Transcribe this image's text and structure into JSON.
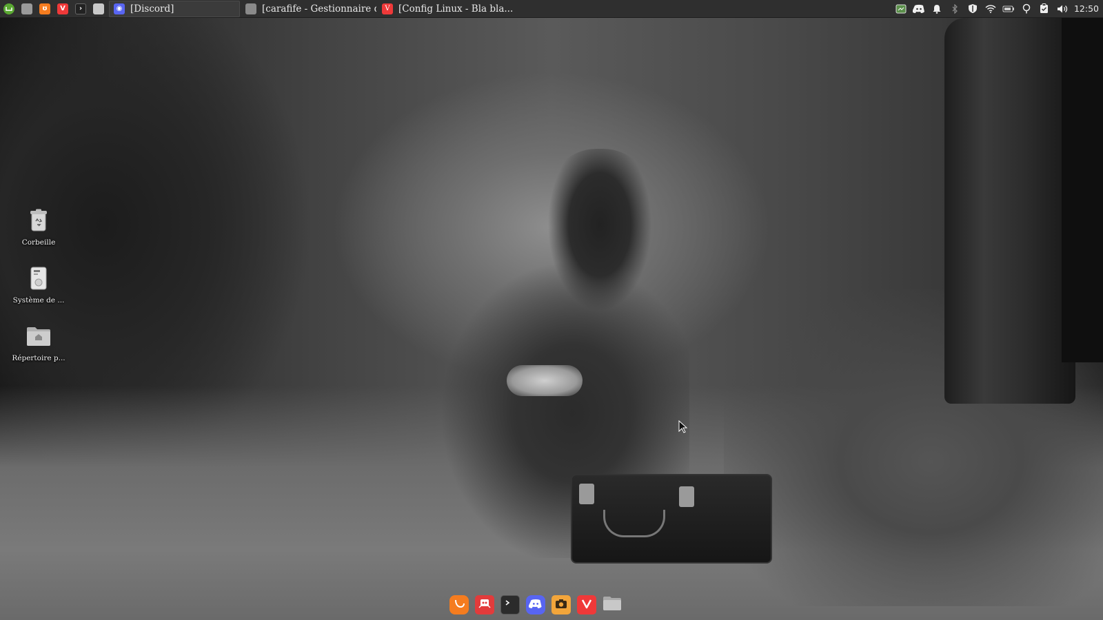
{
  "panel": {
    "launchers": [
      {
        "icon": "mint-menu-icon",
        "color": "#5aa832"
      },
      {
        "icon": "show-desktop-icon",
        "color": "#9a9a9a"
      },
      {
        "icon": "firefox-icon",
        "color": "#f57c1f"
      },
      {
        "icon": "vivaldi-icon",
        "color": "#ef3939"
      },
      {
        "icon": "terminal-icon",
        "color": "#222222"
      },
      {
        "icon": "file-manager-icon",
        "color": "#c9c9c9"
      }
    ],
    "tasks": [
      {
        "label": "[Discord]",
        "icon": "discord-icon",
        "color": "#5865f2",
        "active": true
      },
      {
        "label": "[carafife - Gestionnaire de ...",
        "icon": "folder-icon",
        "color": "#8a8a8a",
        "active": false
      },
      {
        "label": "[Config Linux - Bla bla... - ...",
        "icon": "vivaldi-icon",
        "color": "#ef3939",
        "active": false
      }
    ],
    "tray": [
      "screenshot-app-icon",
      "discord-tray-icon",
      "notifications-icon",
      "bluetooth-icon",
      "shield-icon",
      "wifi-icon",
      "battery-icon",
      "location-icon",
      "clipboard-icon",
      "volume-icon"
    ],
    "clock": "12:50"
  },
  "desktop_icons": [
    {
      "label": "Corbeille",
      "icon": "trash-icon"
    },
    {
      "label": "Système de ...",
      "icon": "drive-icon"
    },
    {
      "label": "Répertoire p...",
      "icon": "home-folder-icon"
    }
  ],
  "dock": [
    {
      "icon": "firefox-icon",
      "color": "#f57c1f"
    },
    {
      "icon": "gitkraken-icon",
      "color": "#e23b3b"
    },
    {
      "icon": "terminal-icon",
      "color": "#2b2b2b"
    },
    {
      "icon": "discord-icon",
      "color": "#5865f2"
    },
    {
      "icon": "screenshot-icon",
      "color": "#f2a53b"
    },
    {
      "icon": "vivaldi-icon",
      "color": "#ef3939"
    },
    {
      "icon": "files-icon",
      "color": "#b8b8b8"
    }
  ]
}
